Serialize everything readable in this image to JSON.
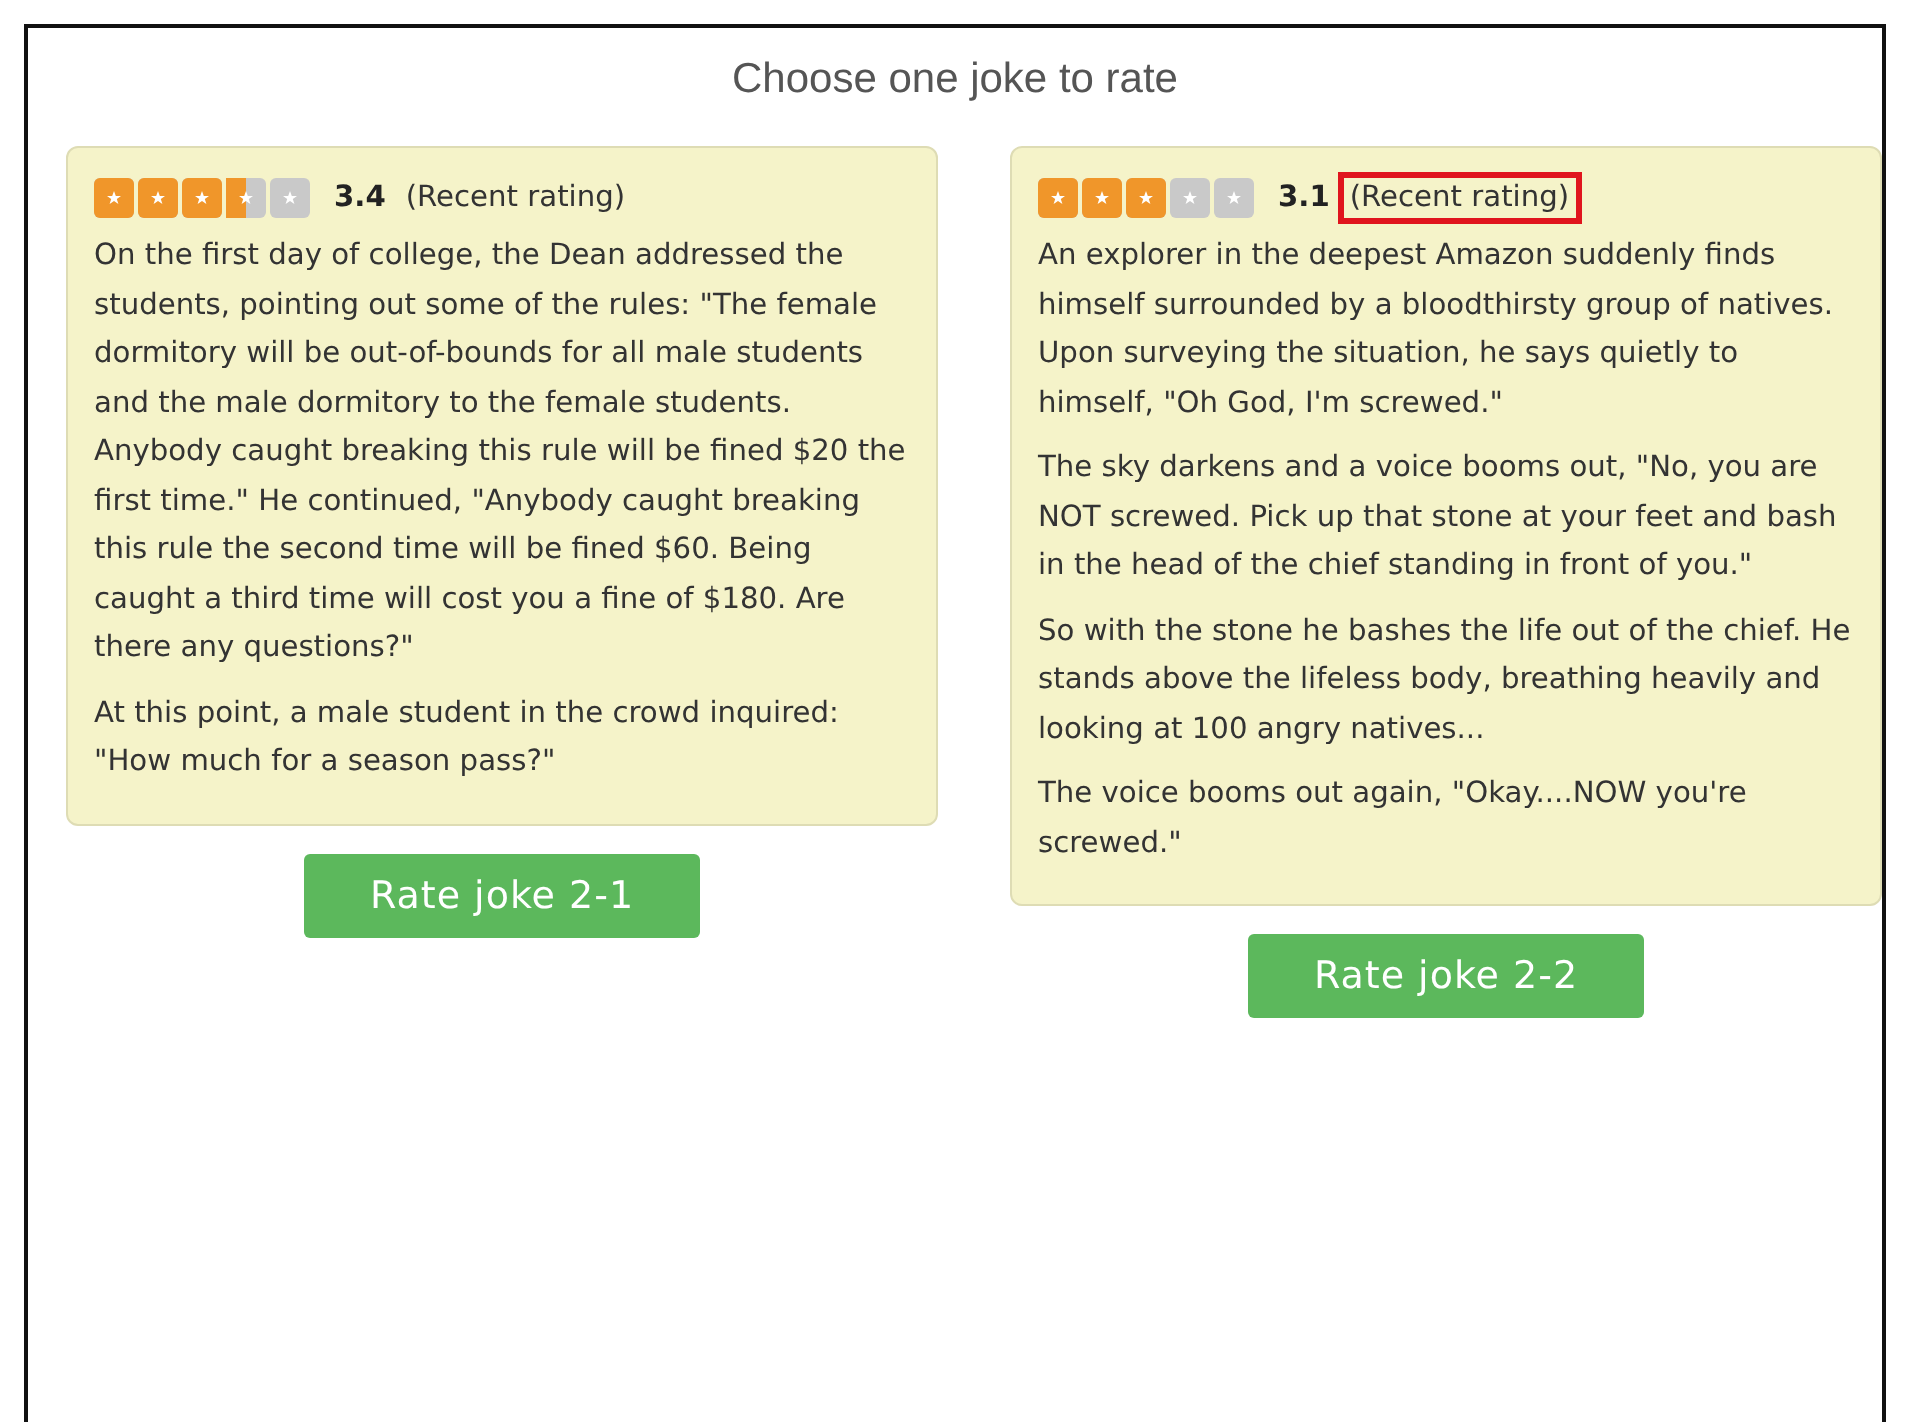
{
  "title": "Choose one joke to rate",
  "jokes": [
    {
      "stars": 3.5,
      "score": "3.4",
      "rating_label": "(Recent rating)",
      "highlighted": false,
      "paragraphs": [
        "On the first day of college, the Dean addressed the students, pointing out some of the rules: \"The female dormitory will be out-of-bounds for all male students and the male dormitory to the female students. Anybody caught breaking this rule will be fined $20 the first time.\" He continued, \"Anybody caught breaking this rule the second time will be fined $60. Being caught a third time will cost you a fine of $180. Are there any questions?\"",
        "At this point, a male student in the crowd inquired: \"How much for a season pass?\""
      ],
      "button": "Rate joke 2-1"
    },
    {
      "stars": 3,
      "score": "3.1",
      "rating_label": "(Recent rating)",
      "highlighted": true,
      "paragraphs": [
        "An explorer in the deepest Amazon suddenly finds himself surrounded by a bloodthirsty group of natives. Upon surveying the situation, he says quietly to himself, \"Oh God, I'm screwed.\"",
        "The sky darkens and a voice booms out, \"No, you are NOT screwed. Pick up that stone at your feet and bash in the head of the chief standing in front of you.\"",
        "So with the stone he bashes the life out of the chief. He stands above the lifeless body, breathing heavily and looking at 100 angry natives...",
        "The voice booms out again, \"Okay....NOW you're screwed.\""
      ],
      "button": "Rate joke 2-2"
    }
  ]
}
